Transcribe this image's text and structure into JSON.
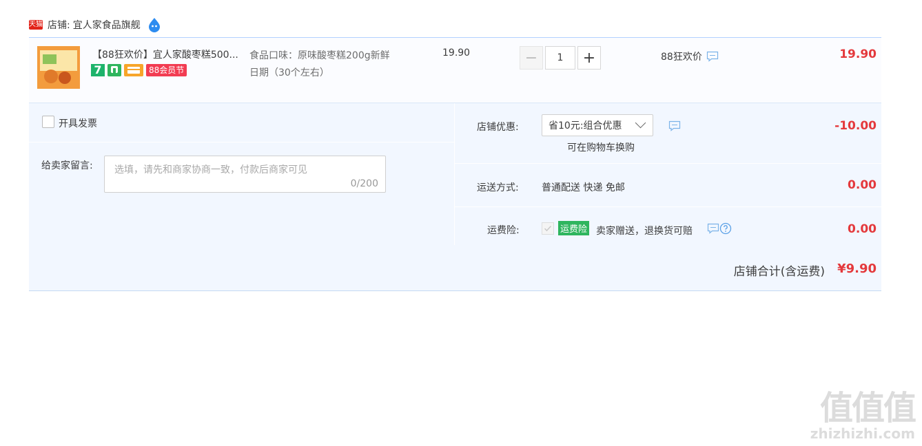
{
  "shop": {
    "badge": "天猫",
    "label": "店铺:",
    "name": "宜人家食品旗舰"
  },
  "item": {
    "title": "【88狂欢价】宜人家酸枣糕500...",
    "badge_seven": "7",
    "badge_88": "88会员节",
    "flavor_line1": "食品口味：原味酸枣糕200g新鲜",
    "flavor_line2": "日期（30个左右）",
    "unit_price": "19.90",
    "qty_minus": "−",
    "qty_value": "1",
    "qty_plus": "+",
    "promo": "88狂欢价",
    "subtotal": "19.90"
  },
  "invoice": {
    "label": "开具发票"
  },
  "memo": {
    "label": "给卖家留言:",
    "placeholder": "选填，请先和商家协商一致，付款后商家可见",
    "count": "0/200"
  },
  "discount": {
    "label": "店铺优惠:",
    "selected": "省10元:组合优惠",
    "note": "可在购物车换购",
    "amount": "-10.00"
  },
  "shipping": {
    "label": "运送方式:",
    "method": "普通配送 快递 免邮",
    "amount": "0.00"
  },
  "insurance": {
    "label": "运费险:",
    "tag": "运费险",
    "text": "卖家赠送，退换货可赔",
    "amount": "0.00"
  },
  "total": {
    "label": "店铺合计(含运费)",
    "amount": "¥9.90"
  },
  "watermark": {
    "big": "值值值",
    "small": "zhizhizhi.com"
  },
  "colors": {
    "accent_red": "#e4393c",
    "tmall_red": "#e2231a",
    "border_blue": "#b2d1ff",
    "panel_bg": "#f2f7ff",
    "green_tag": "#2fb55e"
  }
}
